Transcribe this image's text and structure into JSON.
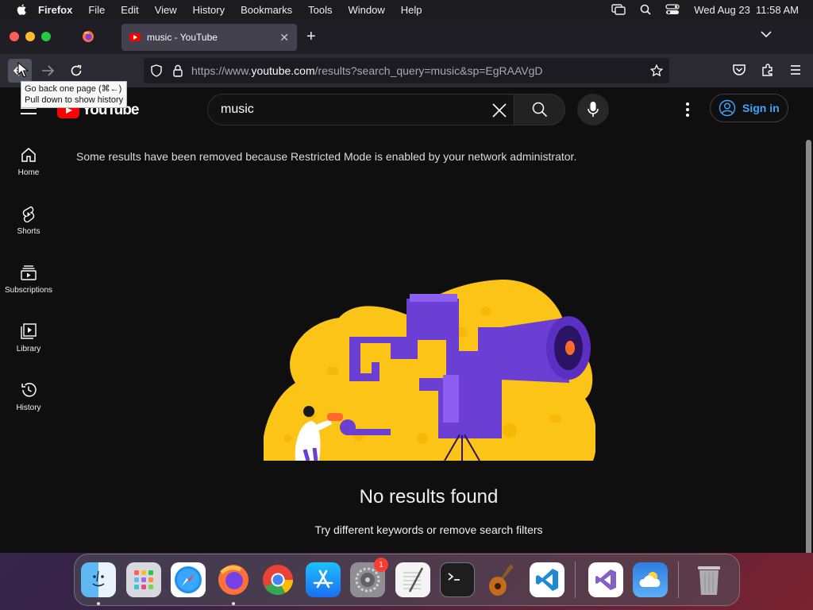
{
  "menubar": {
    "app_name": "Firefox",
    "menus": [
      "File",
      "Edit",
      "View",
      "History",
      "Bookmarks",
      "Tools",
      "Window",
      "Help"
    ],
    "clock": "Wed Aug 23  11:58 AM"
  },
  "browser": {
    "tab_title": "music - YouTube",
    "url_prefix": "https://www.",
    "url_domain": "youtube.com",
    "url_path": "/results?search_query=music&sp=EgRAAVgD",
    "tooltip_line1": "Go back one page (⌘←)",
    "tooltip_line2": "Pull down to show history"
  },
  "youtube": {
    "logo_text": "YouTube",
    "search_value": "music",
    "sign_in_label": "Sign in",
    "notice": "Some results have been removed because Restricted Mode is enabled by your network administrator.",
    "sidebar": [
      {
        "label": "Home",
        "icon": "home-icon"
      },
      {
        "label": "Shorts",
        "icon": "shorts-icon"
      },
      {
        "label": "Subscriptions",
        "icon": "subscriptions-icon"
      },
      {
        "label": "Library",
        "icon": "library-icon"
      },
      {
        "label": "History",
        "icon": "history-icon"
      }
    ],
    "no_results_title": "No results found",
    "no_results_hint": "Try different keywords or remove search filters"
  },
  "dock": {
    "apps": [
      "Finder",
      "Launchpad",
      "Safari",
      "Firefox",
      "Chrome",
      "App Store",
      "System Settings",
      "TextEdit",
      "Terminal",
      "Instruments",
      "Visual Studio Code",
      "Visual Studio",
      "Weather",
      "Trash"
    ],
    "system_settings_badge": "1"
  },
  "colors": {
    "youtube_red": "#ff0000",
    "link_blue": "#3ea6ff",
    "illustration_yellow": "#fcc417",
    "illustration_purple": "#6b3fd4"
  }
}
